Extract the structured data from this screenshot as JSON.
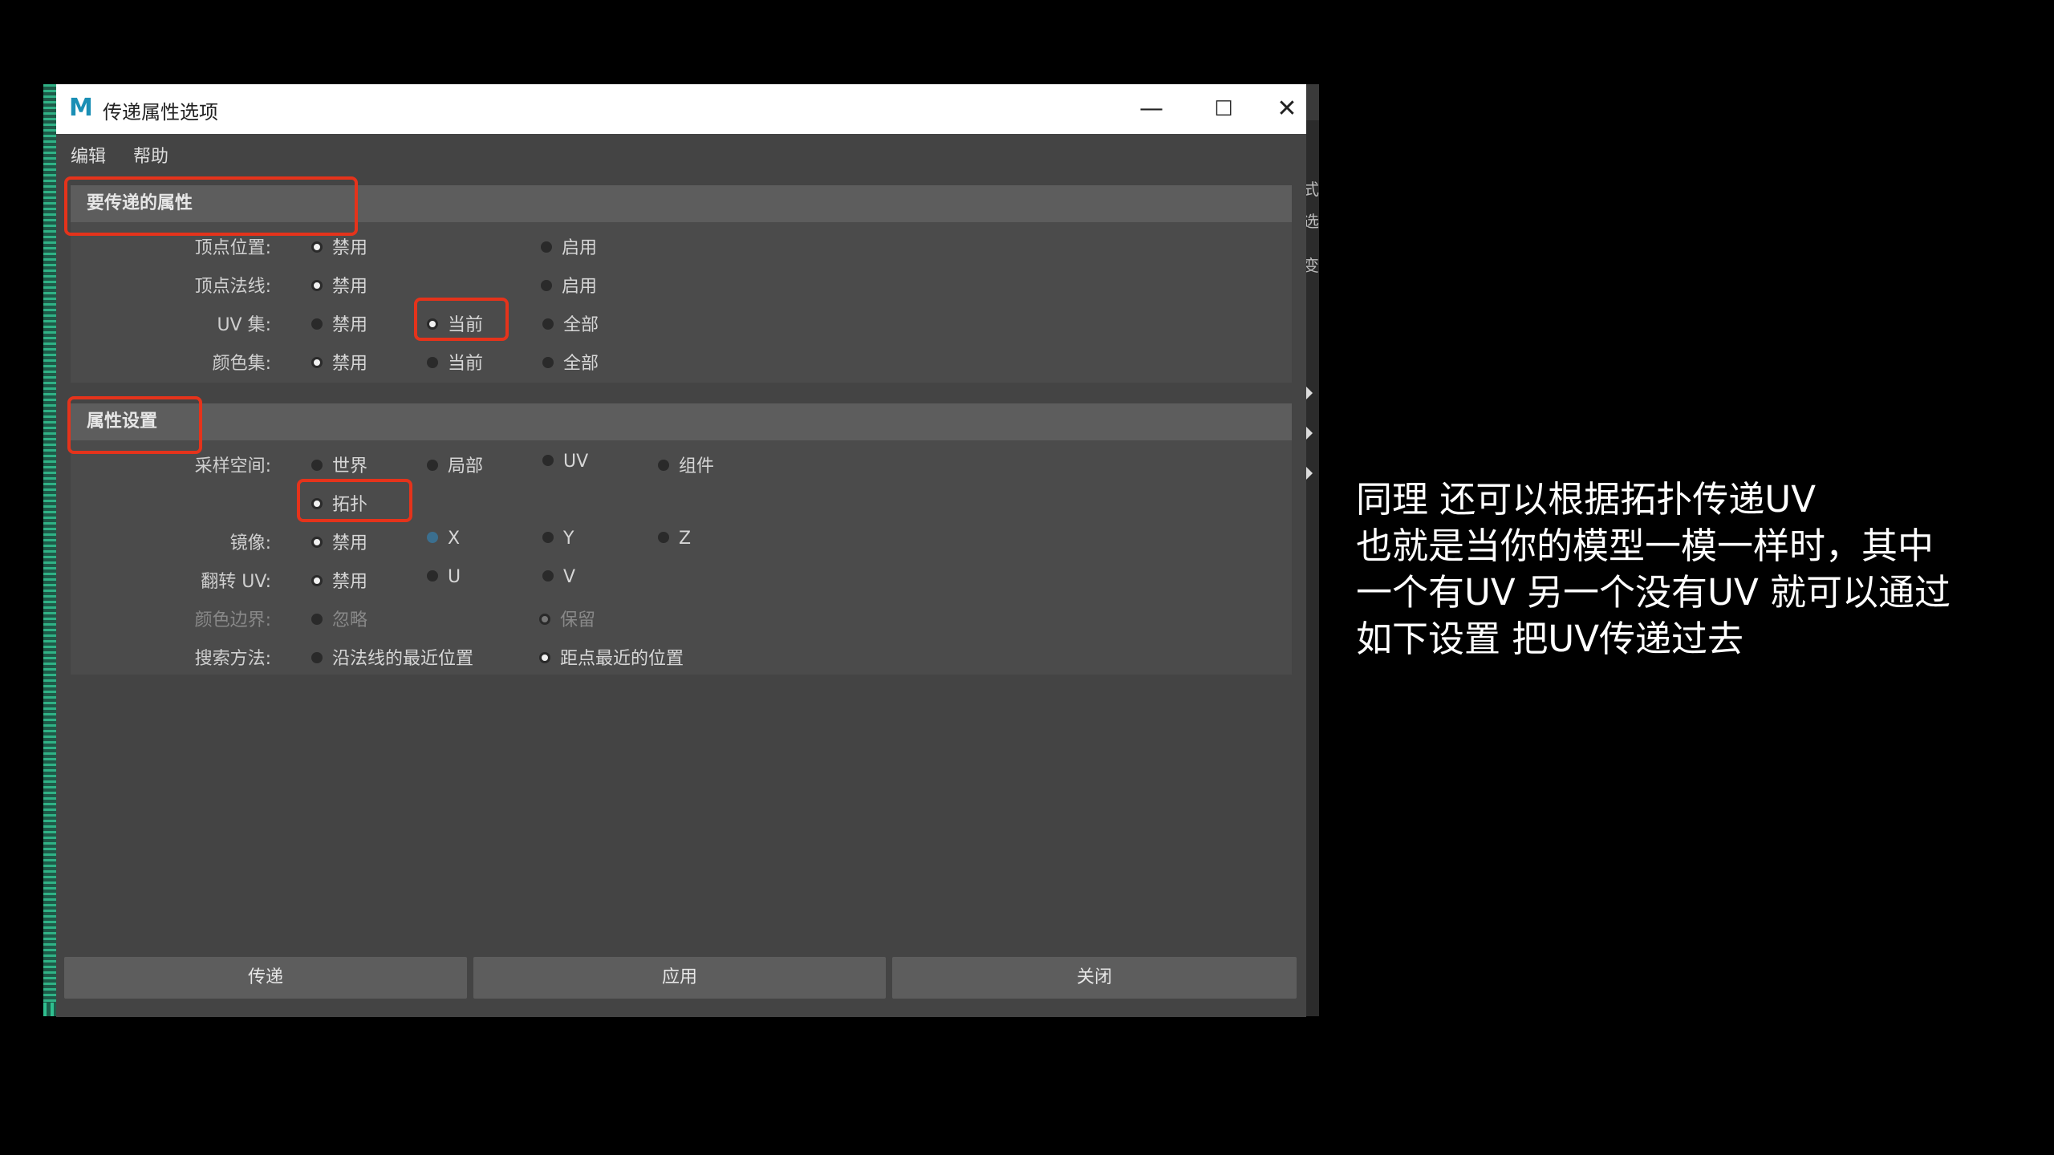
{
  "window": {
    "title": "传递属性选项",
    "icon": "maya-logo-icon",
    "controls": {
      "minimize": "—",
      "maximize": "☐",
      "close": "✕"
    }
  },
  "menu": {
    "edit": "编辑",
    "help": "帮助"
  },
  "section1": {
    "title": "要传递的属性",
    "rows": [
      {
        "label": "顶点位置:",
        "options": [
          "禁用",
          "启用"
        ],
        "selected": 0
      },
      {
        "label": "顶点法线:",
        "options": [
          "禁用",
          "启用"
        ],
        "selected": 0
      },
      {
        "label": "UV 集:",
        "options": [
          "禁用",
          "当前",
          "全部"
        ],
        "selected": 1
      },
      {
        "label": "颜色集:",
        "options": [
          "禁用",
          "当前",
          "全部"
        ],
        "selected": 0
      }
    ]
  },
  "section2": {
    "title": "属性设置",
    "sampling": {
      "label": "采样空间:",
      "options": [
        "世界",
        "局部",
        "UV",
        "组件",
        "拓扑"
      ],
      "selected": 4
    },
    "mirror": {
      "label": "镜像:",
      "options": [
        "禁用",
        "X",
        "Y",
        "Z"
      ],
      "selected": 0
    },
    "flip_uv": {
      "label": "翻转 UV:",
      "options": [
        "禁用",
        "U",
        "V"
      ],
      "selected": 0
    },
    "color_border": {
      "label": "颜色边界:",
      "options": [
        "忽略",
        "保留"
      ],
      "selected": 1,
      "disabled": true
    },
    "search": {
      "label": "搜索方法:",
      "options": [
        "沿法线的最近位置",
        "距点最近的位置"
      ],
      "selected": 1
    }
  },
  "buttons": {
    "transfer": "传递",
    "apply": "应用",
    "close": "关闭"
  },
  "caption": {
    "line1": "同理 还可以根据拓扑传递UV",
    "line2": "也就是当你的模型一模一样时，其中",
    "line3": "一个有UV 另一个没有UV 就可以通过",
    "line4": "如下设置 把UV传递过去"
  },
  "side_text": {
    "a": "式",
    "b": "选",
    "c": "变"
  },
  "colors": {
    "highlight": "#e5331b",
    "panel": "#444444",
    "header": "#5d5d5d"
  }
}
